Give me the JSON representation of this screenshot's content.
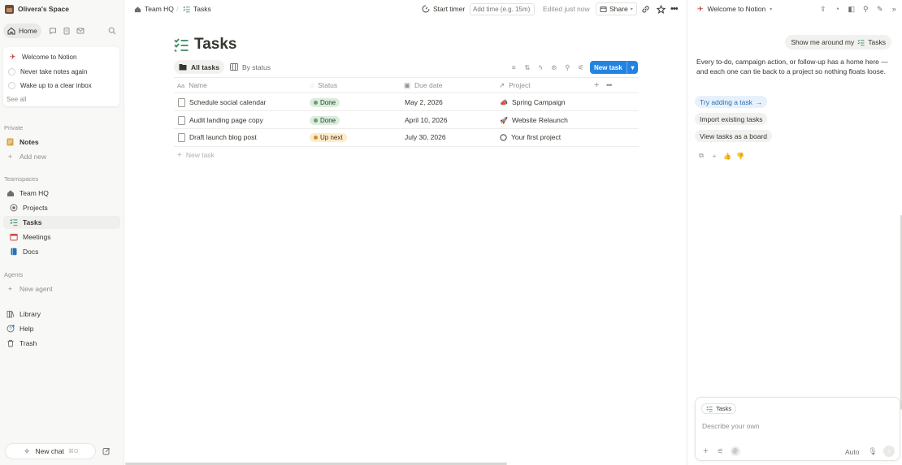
{
  "sidebar": {
    "workspace_name": "Olivera's Space",
    "home_label": "Home",
    "welcome": {
      "title": "Welcome to Notion",
      "items": [
        "Never take notes again",
        "Wake up to a clear inbox"
      ],
      "see_all": "See all"
    },
    "private_label": "Private",
    "notes_label": "Notes",
    "add_new_label": "Add new",
    "teamspaces_label": "Teamspaces",
    "team_hq_label": "Team HQ",
    "team_items": [
      {
        "label": "Projects",
        "icon": "target-icon"
      },
      {
        "label": "Tasks",
        "icon": "checklist-icon",
        "active": true
      },
      {
        "label": "Meetings",
        "icon": "calendar-icon"
      },
      {
        "label": "Docs",
        "icon": "book-icon"
      }
    ],
    "agents_label": "Agents",
    "new_agent_label": "New agent",
    "library_label": "Library",
    "help_label": "Help",
    "trash_label": "Trash",
    "new_chat_label": "New chat",
    "new_chat_shortcut": "⌘O"
  },
  "topbar": {
    "breadcrumb_team": "Team HQ",
    "breadcrumb_sep": "/",
    "breadcrumb_page": "Tasks",
    "start_timer": "Start timer",
    "time_placeholder": "Add time (e.g. 15m)",
    "edited": "Edited just now",
    "share": "Share"
  },
  "page": {
    "title": "Tasks",
    "views": [
      {
        "label": "All tasks",
        "active": true
      },
      {
        "label": "By status",
        "active": false
      }
    ],
    "new_task_button": "New task",
    "columns": [
      "Name",
      "Status",
      "Due date",
      "Project"
    ],
    "rows": [
      {
        "name": "Schedule social calendar",
        "status": "Done",
        "due": "May 2, 2026",
        "project": "Spring Campaign",
        "project_icon": "megaphone-icon"
      },
      {
        "name": "Audit landing page copy",
        "status": "Done",
        "due": "April 10, 2026",
        "project": "Website Relaunch",
        "project_icon": "rocket-icon"
      },
      {
        "name": "Draft launch blog post",
        "status": "Up next",
        "due": "July 30, 2026",
        "project": "Your first project",
        "project_icon": "circle-icon"
      }
    ],
    "new_task_row": "New task"
  },
  "panel": {
    "title": "Welcome to Notion",
    "user_message_prefix": "Show me around my",
    "user_message_page": "Tasks",
    "body": "Every to-do, campaign action, or follow-up has a home here — and each one can tie back to a project so nothing floats loose.",
    "suggestions": [
      {
        "label": "Try adding a task",
        "arrow": "→"
      },
      {
        "label": "Import existing tasks"
      },
      {
        "label": "View tasks as a board"
      }
    ],
    "context_chip": "Tasks",
    "input_placeholder": "Describe your own",
    "mode": "Auto"
  },
  "colors": {
    "accent": "#2383e2",
    "done_bg": "#dbeddb",
    "done_text": "#1c3829",
    "done_dot": "#6c9b7d",
    "upnext_bg": "#fdecc8",
    "upnext_text": "#402c1b",
    "upnext_dot": "#cb912f"
  }
}
